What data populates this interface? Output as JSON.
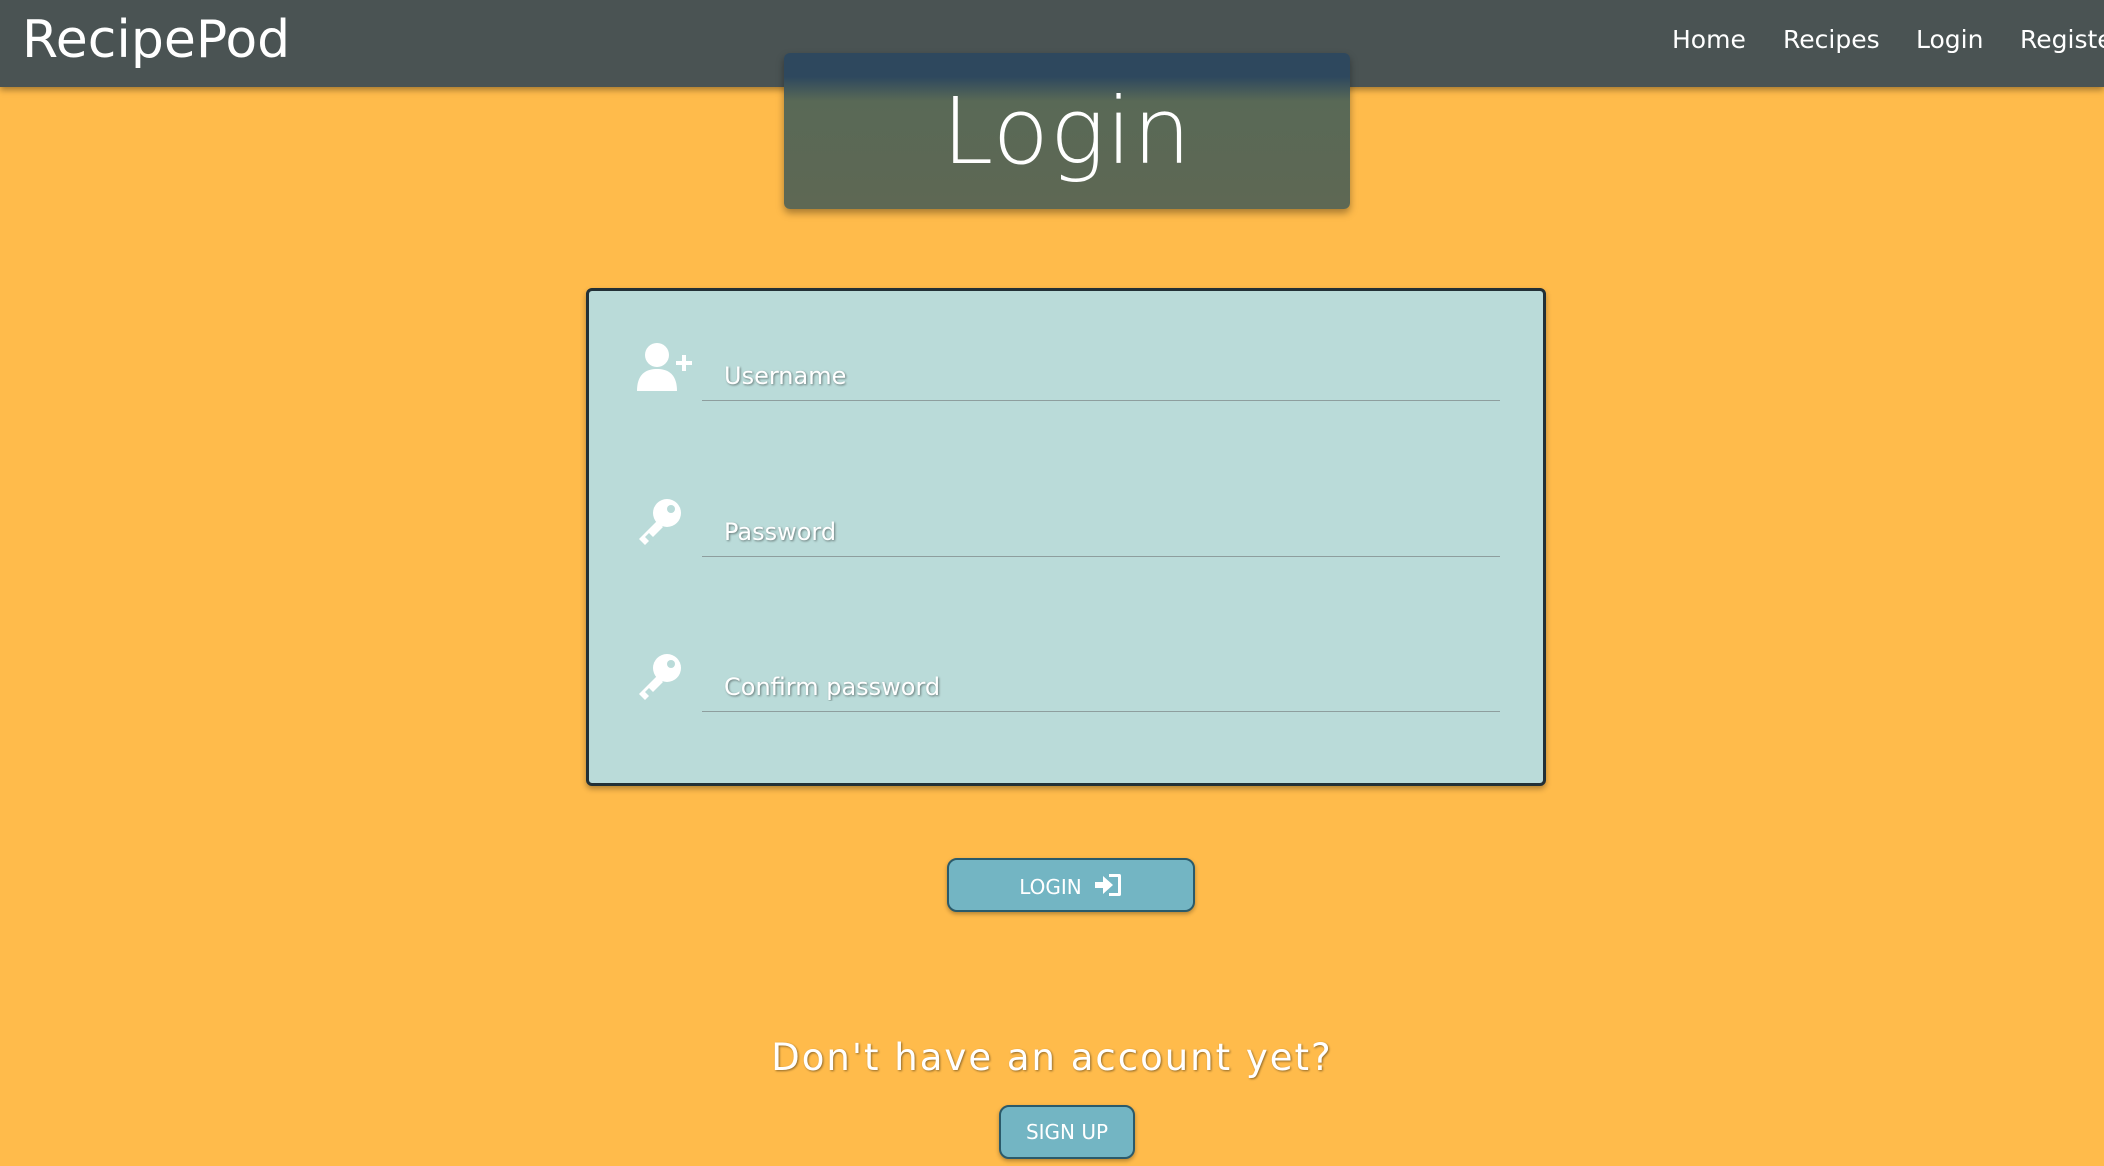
{
  "navbar": {
    "brand": "RecipePod",
    "links": [
      {
        "label": "Home"
      },
      {
        "label": "Recipes"
      },
      {
        "label": "Login"
      },
      {
        "label": "Registe"
      }
    ],
    "background_color": "#4A5353"
  },
  "page_title": "Login",
  "form": {
    "fields": [
      {
        "icon": "user-plus-icon",
        "placeholder": "Username",
        "value": ""
      },
      {
        "icon": "key-icon",
        "placeholder": "Password",
        "value": ""
      },
      {
        "icon": "key-icon",
        "placeholder": "Confirm password",
        "value": ""
      }
    ],
    "card_color": "#BADBD9"
  },
  "login_button": {
    "label": "LOGIN",
    "icon": "sign-in-icon"
  },
  "signup_prompt": "Don't have an account yet?",
  "signup_button": {
    "label": "SIGN UP"
  },
  "colors": {
    "page_background": "#FFBB4B",
    "button": "#73B5C3"
  }
}
